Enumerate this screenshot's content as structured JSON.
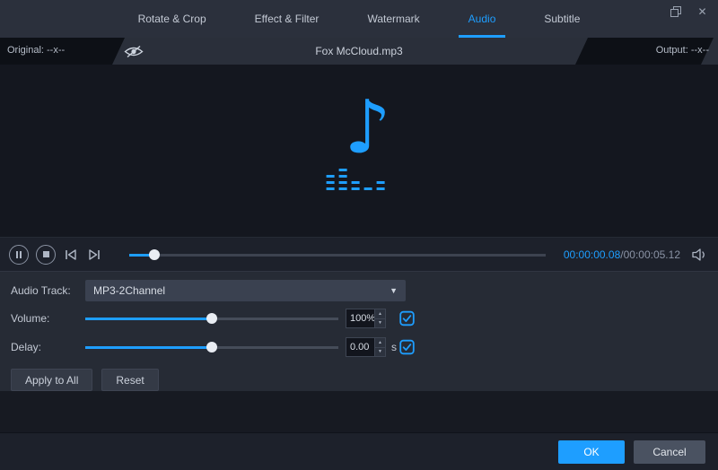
{
  "tabs": [
    {
      "label": "Rotate & Crop",
      "active": false
    },
    {
      "label": "Effect & Filter",
      "active": false
    },
    {
      "label": "Watermark",
      "active": false
    },
    {
      "label": "Audio",
      "active": true
    },
    {
      "label": "Subtitle",
      "active": false
    }
  ],
  "window_controls": {
    "close_glyph": "✕"
  },
  "info_bar": {
    "original_label": "Original: --x--",
    "filename": "Fox McCloud.mp3",
    "output_label": "Output: --x--"
  },
  "preview": {
    "music_note_glyph": "♪"
  },
  "player": {
    "time_current": "00:00:00.08",
    "time_separator": "/",
    "time_total": "00:00:05.12"
  },
  "settings": {
    "audio_track_label": "Audio Track:",
    "audio_track_value": "MP3-2Channel",
    "volume_label": "Volume:",
    "volume_value": "100%",
    "delay_label": "Delay:",
    "delay_value": "0.00",
    "delay_unit": "s",
    "apply_all_label": "Apply to All",
    "reset_label": "Reset"
  },
  "footer": {
    "ok_label": "OK",
    "cancel_label": "Cancel"
  },
  "icons": {
    "dropdown_arrow": "▼",
    "spinner_up": "▲",
    "spinner_down": "▼"
  },
  "colors": {
    "accent": "#1e9eff"
  }
}
